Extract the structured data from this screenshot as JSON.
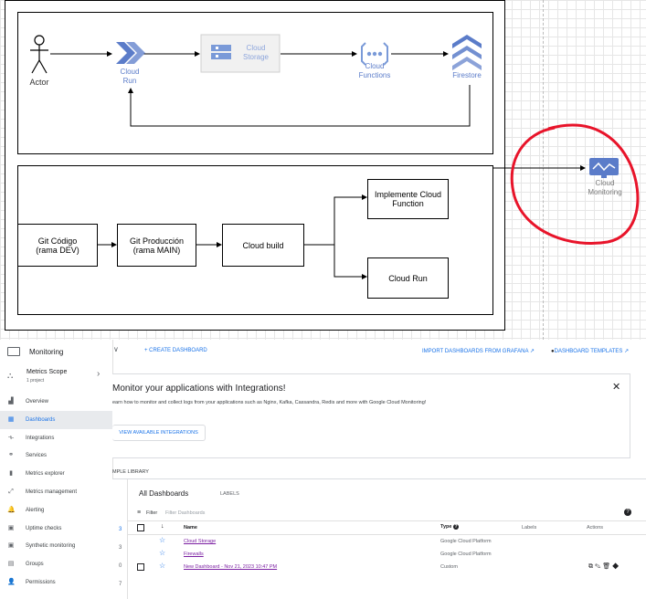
{
  "diagram": {
    "nodes": {
      "actor": "Actor",
      "cloud_run": "Cloud\nRun",
      "cloud_storage": "Cloud\nStorage",
      "cloud_functions": "Cloud\nFunctions",
      "firestore": "Firestore",
      "cloud_monitoring": "Cloud\nMonitoring"
    },
    "pipeline": {
      "git_codigo": "Git Código\n(rama DEV)",
      "git_produccion": "Git Producción\n(rama MAIN)",
      "cloud_build": "Cloud build",
      "implemente_cf": "Implemente Cloud\nFunction",
      "cloud_run": "Cloud Run"
    },
    "colors": {
      "accent_blue": "#5b7cc9",
      "highlight_red": "#e8142a"
    }
  },
  "monitoring": {
    "product": "Monitoring",
    "top_actions": {
      "create_dashboard": "+ CREATE DASHBOARD",
      "import_grafana": "IMPORT DASHBOARDS FROM GRAFANA",
      "dashboard_templates": "DASHBOARD TEMPLATES"
    },
    "metrics_scope": {
      "title": "Metrics Scope",
      "subtitle": "1 project"
    },
    "nav": [
      {
        "label": "Overview",
        "icon": "overview-icon",
        "glyph": "▟"
      },
      {
        "label": "Dashboards",
        "icon": "dashboards-icon",
        "glyph": "▦",
        "active": true
      },
      {
        "label": "Integrations",
        "icon": "integrations-icon",
        "glyph": "⟛"
      },
      {
        "label": "Services",
        "icon": "services-icon",
        "glyph": "⚭"
      },
      {
        "label": "Metrics explorer",
        "icon": "metrics-explorer-icon",
        "glyph": "▮"
      },
      {
        "label": "Metrics management",
        "icon": "metrics-management-icon",
        "glyph": "⤢"
      },
      {
        "label": "Alerting",
        "icon": "alerting-icon",
        "glyph": "🔔"
      },
      {
        "label": "Uptime checks",
        "icon": "uptime-icon",
        "glyph": "▣"
      },
      {
        "label": "Synthetic monitoring",
        "icon": "synthetic-icon",
        "glyph": "▣"
      },
      {
        "label": "Groups",
        "icon": "groups-icon",
        "glyph": "▤"
      },
      {
        "label": "Permissions",
        "icon": "permissions-icon",
        "glyph": "👤"
      }
    ],
    "banner": {
      "title": "Monitor your applications with Integrations!",
      "body": "earn how to monitor and collect logs from your applications such as Nginx, Kafka, Cassandra, Redis and more with Google Cloud Monitoring!",
      "button": "VIEW AVAILABLE INTEGRATIONS"
    },
    "sample_library": "MPLE LIBRARY",
    "tabs": {
      "all": "All Dashboards",
      "labels": "LABELS"
    },
    "filter": {
      "label": "Filter",
      "placeholder": "Filter Dashboards"
    },
    "side_counts": [
      "3",
      "3",
      "0",
      "7"
    ],
    "table": {
      "headers": {
        "name": "Name",
        "type": "Type",
        "labels": "Labels",
        "actions": "Actions"
      },
      "rows": [
        {
          "name": "Cloud Storage",
          "type": "Google Cloud Platform"
        },
        {
          "name": "Firewalls",
          "type": "Google Cloud Platform"
        },
        {
          "name": "New Dashboard - Nov 21, 2023 10:47 PM",
          "type": "Custom"
        }
      ]
    }
  }
}
